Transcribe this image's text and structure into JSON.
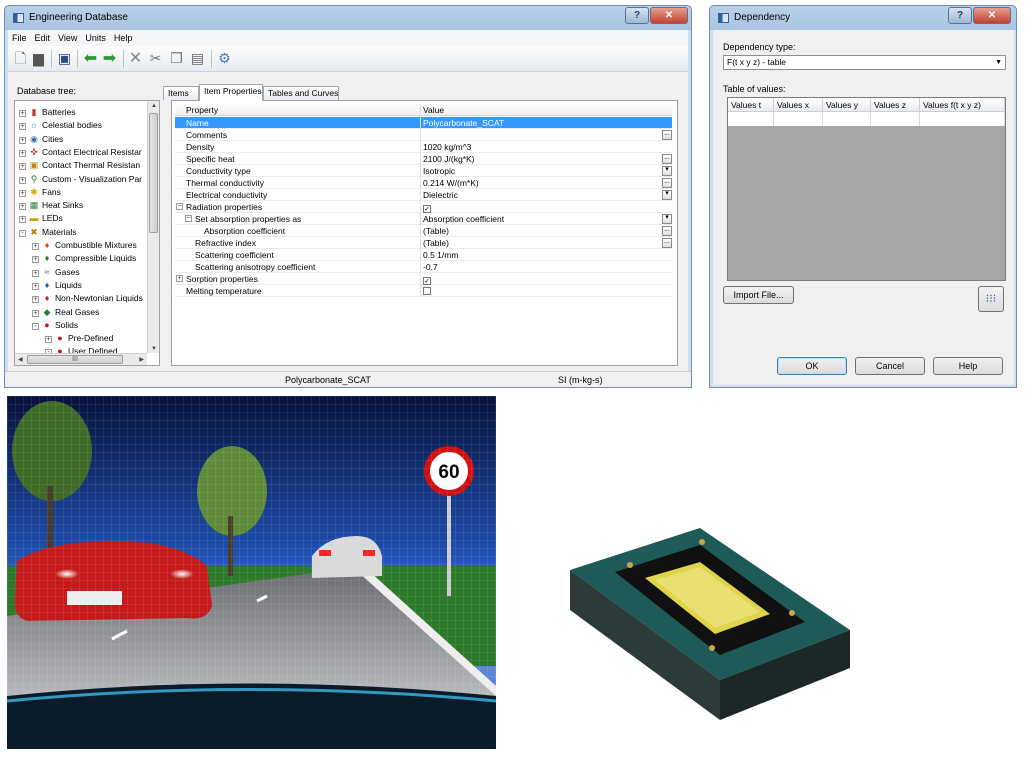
{
  "eng_db": {
    "title": "Engineering Database",
    "menu": [
      "File",
      "Edit",
      "View",
      "Units",
      "Help"
    ],
    "tree_label": "Database tree:",
    "tree": [
      {
        "label": "Batteries",
        "icon": "battery",
        "level": 0,
        "exp": "+"
      },
      {
        "label": "Celestial bodies",
        "icon": "celestial",
        "level": 0,
        "exp": "+"
      },
      {
        "label": "Cities",
        "icon": "city",
        "level": 0,
        "exp": "+"
      },
      {
        "label": "Contact Electrical Resistar",
        "icon": "contact-electrical",
        "level": 0,
        "exp": "+"
      },
      {
        "label": "Contact Thermal Resistan",
        "icon": "contact-thermal",
        "level": 0,
        "exp": "+"
      },
      {
        "label": "Custom - Visualization Par",
        "icon": "custom-visualization",
        "level": 0,
        "exp": "+"
      },
      {
        "label": "Fans",
        "icon": "fan",
        "level": 0,
        "exp": "+"
      },
      {
        "label": "Heat Sinks",
        "icon": "heat-sink",
        "level": 0,
        "exp": "+"
      },
      {
        "label": "LEDs",
        "icon": "led",
        "level": 0,
        "exp": "+"
      },
      {
        "label": "Materials",
        "icon": "materials",
        "level": 0,
        "exp": "-"
      },
      {
        "label": "Combustible Mixtures",
        "icon": "flame",
        "level": 1,
        "exp": "+"
      },
      {
        "label": "Compressible Liquids",
        "icon": "liquid-green",
        "level": 1,
        "exp": "+"
      },
      {
        "label": "Gases",
        "icon": "gas",
        "level": 1,
        "exp": "+"
      },
      {
        "label": "Liquids",
        "icon": "liquid-blue",
        "level": 1,
        "exp": "+"
      },
      {
        "label": "Non-Newtonian Liquids",
        "icon": "liquid-red",
        "level": 1,
        "exp": "+"
      },
      {
        "label": "Real Gases",
        "icon": "real-gas",
        "level": 1,
        "exp": "+"
      },
      {
        "label": "Solids",
        "icon": "solids",
        "level": 1,
        "exp": "-"
      },
      {
        "label": "Pre-Defined",
        "icon": "solids",
        "level": 2,
        "exp": "+"
      },
      {
        "label": "User Defined",
        "icon": "solids",
        "level": 2,
        "exp": "-"
      }
    ],
    "tree_hscroll_label": "III",
    "tabs": [
      "Items",
      "Item Properties",
      "Tables and Curves"
    ],
    "grid_header": {
      "property": "Property",
      "value": "Value"
    },
    "rows": [
      {
        "property": "Name",
        "value": "Polycarbonate_SCAT",
        "indent": 0,
        "selected": true,
        "btn": ""
      },
      {
        "property": "Comments",
        "value": "",
        "indent": 0,
        "btn": "..."
      },
      {
        "property": "Density",
        "value": "1020 kg/m^3",
        "indent": 0,
        "btn": ""
      },
      {
        "property": "Specific heat",
        "value": "2100 J/(kg*K)",
        "indent": 0,
        "btn": "..."
      },
      {
        "property": "Conductivity type",
        "value": "Isotropic",
        "indent": 0,
        "btn": "▾"
      },
      {
        "property": "Thermal conductivity",
        "value": "0.214 W/(m*K)",
        "indent": 0,
        "btn": "..."
      },
      {
        "property": "Electrical conductivity",
        "value": "Dielectric",
        "indent": 0,
        "btn": "▾"
      },
      {
        "property": "Radiation properties",
        "value": "✓",
        "indent": 0,
        "exp": "−",
        "check": true,
        "btn": ""
      },
      {
        "property": "Set absorption properties as",
        "value": "Absorption coefficient",
        "indent": 1,
        "exp": "−",
        "btn": "▾"
      },
      {
        "property": "Absorption coefficient",
        "value": "(Table)",
        "indent": 2,
        "btn": "..."
      },
      {
        "property": "Refractive index",
        "value": "(Table)",
        "indent": 1,
        "btn": "..."
      },
      {
        "property": "Scattering coefficient",
        "value": "0.5 1/mm",
        "indent": 1,
        "btn": ""
      },
      {
        "property": "Scattering anisotropy coefficient",
        "value": "-0.7",
        "indent": 1,
        "btn": ""
      },
      {
        "property": "Sorption properties",
        "value": "✓",
        "indent": 0,
        "exp": "+",
        "check": true,
        "btn": ""
      },
      {
        "property": "Melting temperature",
        "value": "",
        "indent": 0,
        "check": true,
        "btn": ""
      }
    ],
    "status": {
      "item": "Polycarbonate_SCAT",
      "units": "SI (m-kg-s)"
    }
  },
  "dependency": {
    "title": "Dependency",
    "type_label": "Dependency type:",
    "type_value": "F(t x y z) - table",
    "table_label": "Table of values:",
    "columns": [
      "Values t",
      "Values x",
      "Values y",
      "Values z",
      "Values f(t x y z)"
    ],
    "import_label": "Import File...",
    "ok_label": "OK",
    "cancel_label": "Cancel",
    "help_label": "Help"
  },
  "scene": {
    "speed_sign": "60"
  },
  "colors": {
    "selection": "#3399ff",
    "window_frame": "#a9c4e2",
    "toolbar_green": "#2f9a2f"
  }
}
